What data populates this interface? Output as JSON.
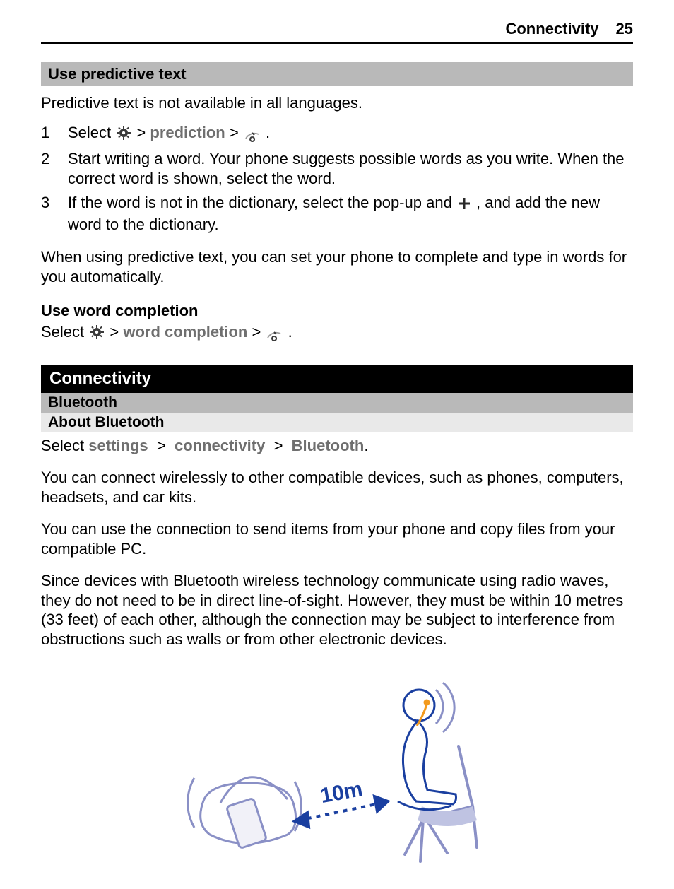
{
  "header": {
    "section": "Connectivity",
    "page": "25"
  },
  "sec1": {
    "title": "Use predictive text",
    "intro": "Predictive text is not available in all languages.",
    "steps": [
      {
        "n": "1",
        "pre": "Select ",
        "mid": "prediction"
      },
      {
        "n": "2",
        "text": "Start writing a word. Your phone suggests possible words as you write. When the correct word is shown, select the word."
      },
      {
        "n": "3",
        "pre": "If the word is not in the dictionary, select the pop-up and ",
        "post": ", and add the new word to the dictionary."
      }
    ],
    "outro": "When using predictive text, you can set your phone to complete and type in words for you automatically.",
    "sub": "Use word completion",
    "subline_pre": "Select ",
    "subline_mid": "word completion"
  },
  "chapter": "Connectivity",
  "sec2": {
    "h1": "Bluetooth",
    "h2": "About Bluetooth",
    "nav_select": "Select ",
    "nav_settings": "settings",
    "nav_conn": "connectivity",
    "nav_bt": "Bluetooth",
    "p1": "You can connect wirelessly to other compatible devices, such as phones, computers, headsets, and car kits.",
    "p2": "You can use the connection to send items from your phone and copy files from your compatible PC.",
    "p3": "Since devices with Bluetooth wireless technology communicate using radio waves, they do not need to be in direct line-of-sight. However, they must be within 10 metres (33 feet) of each other, although the connection may be subject to interference from obstructions such as walls or from other electronic devices."
  },
  "figure": {
    "distance": "10m"
  },
  "glyphs": {
    "gt": ">",
    "period": "."
  }
}
